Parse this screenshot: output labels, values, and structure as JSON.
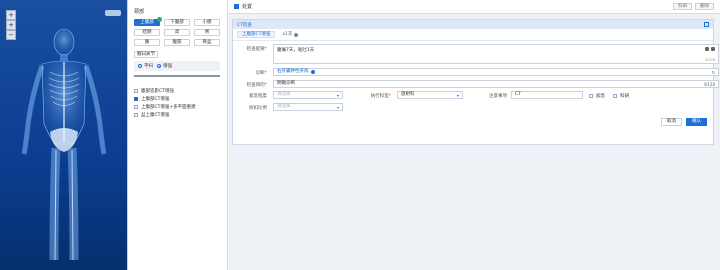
{
  "body_panel": {
    "zoom_controls": [
      "+",
      "+",
      "−"
    ]
  },
  "selector": {
    "section_title": "颈部",
    "parts": [
      "上腹部",
      "下腹部",
      "小肠",
      "结肠",
      "肾",
      "胃",
      "胰",
      "腹部",
      "骨盆"
    ],
    "active_part_index": 0,
    "sub_label": "髋臼关节",
    "planes": [
      {
        "label": "平扫",
        "on": false
      },
      {
        "label": "增强",
        "on": true
      }
    ],
    "options": [
      {
        "label": "腹部造影CT增强",
        "checked": false
      },
      {
        "label": "上腹部CT增强",
        "checked": true
      },
      {
        "label": "上腹部CT增强+多平面重建",
        "checked": false
      },
      {
        "label": "盆上腹CT增强",
        "checked": false
      }
    ]
  },
  "topbar": {
    "title": "处置",
    "buttons": [
      "科研",
      "删除"
    ]
  },
  "card": {
    "title": "CT检查",
    "tabs": [
      {
        "label": "上腹部CT增强",
        "active": true
      },
      {
        "label": "x1次",
        "active": false
      }
    ],
    "complaint": {
      "label": "检查提要",
      "value": "腹痛7天，呕吐1天",
      "counter": "9/128"
    },
    "diagnosis": {
      "label": "诊断",
      "tag": "右肝囊肿性肝病"
    },
    "purpose": {
      "label": "检查目的",
      "value": "明确诊断",
      "counter": "4/128"
    },
    "urgency": {
      "label": "紧急程度",
      "placeholder": "请选择"
    },
    "exec_dept": {
      "label": "执行科室",
      "value": "放射科"
    },
    "notes": {
      "label": "注意事项",
      "value": "CT"
    },
    "checks": [
      "加急",
      "科研"
    ],
    "relation": {
      "label": "拆扣比例",
      "placeholder": "请选择"
    },
    "cancel_label": "取消",
    "ok_label": "确认"
  }
}
